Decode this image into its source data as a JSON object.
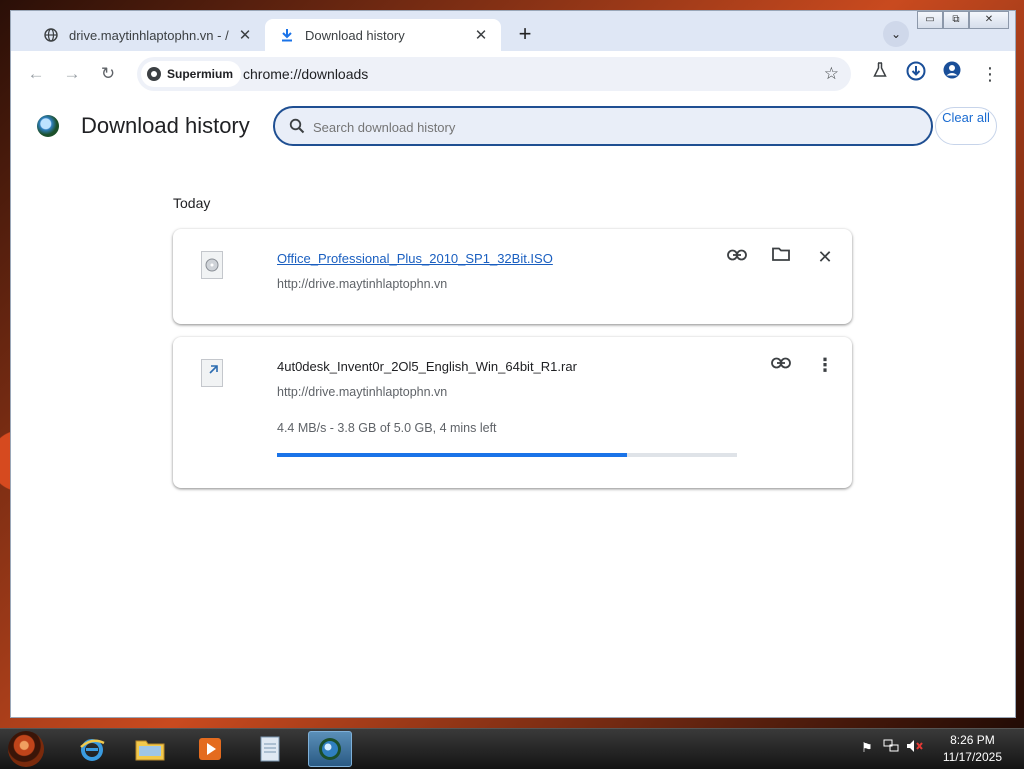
{
  "tabs": [
    {
      "label": "drive.maytinhlaptophn.vn - /",
      "close": "✕"
    },
    {
      "label": "Download history",
      "close": "✕"
    }
  ],
  "toolbar": {
    "site_chip": "Supermium",
    "url": "chrome://downloads"
  },
  "page": {
    "title": "Download history",
    "search_placeholder": "Search download history",
    "clear_all": "Clear all",
    "section_label": "Today"
  },
  "downloads": [
    {
      "filename": "Office_Professional_Plus_2010_SP1_32Bit.ISO",
      "source": "http://drive.maytinhlaptophn.vn",
      "completed": true
    },
    {
      "filename": "4ut0desk_Invent0r_2Ol5_English_Win_64bit_R1.rar",
      "source": "http://drive.maytinhlaptophn.vn",
      "status": "4.4 MB/s - 3.8 GB of 5.0 GB, 4 mins left",
      "progress_fraction": 0.76,
      "completed": false
    }
  ],
  "clock": {
    "time": "8:26 PM",
    "date": "11/17/2025"
  },
  "colors": {
    "accent": "#1a73e8",
    "link": "#1a5fc0",
    "tabstrip": "#dfe7f5",
    "search_border": "#1f4f92"
  }
}
